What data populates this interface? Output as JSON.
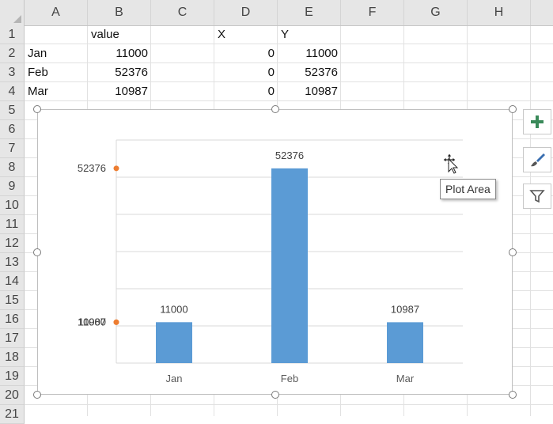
{
  "columns": [
    "A",
    "B",
    "C",
    "D",
    "E",
    "F",
    "G",
    "H"
  ],
  "rows": [
    "1",
    "2",
    "3",
    "4",
    "5",
    "6",
    "7",
    "8",
    "9",
    "10",
    "11",
    "12",
    "13",
    "14",
    "15",
    "16",
    "17",
    "18",
    "19",
    "20",
    "21"
  ],
  "cells": {
    "header": {
      "value": "value",
      "x": "X",
      "y": "Y"
    },
    "data": [
      {
        "label": "Jan",
        "value": "11000",
        "x": "0",
        "y": "11000"
      },
      {
        "label": "Feb",
        "value": "52376",
        "x": "0",
        "y": "52376"
      },
      {
        "label": "Mar",
        "value": "10987",
        "x": "0",
        "y": "10987"
      }
    ]
  },
  "chart_data": {
    "type": "bar",
    "categories": [
      "Jan",
      "Feb",
      "Mar"
    ],
    "values": [
      11000,
      52376,
      10987
    ],
    "data_labels": [
      "11000",
      "52376",
      "10987"
    ],
    "ylim": [
      0,
      60000
    ],
    "grid": true,
    "bar_color": "#5b9bd5",
    "overlay_scatter": {
      "color": "#ed7d31",
      "points": [
        {
          "x": 0,
          "y": 11000,
          "label": "11000"
        },
        {
          "x": 0,
          "y": 52376,
          "label": "52376"
        },
        {
          "x": 0,
          "y": 10987,
          "label": "10987"
        }
      ]
    }
  },
  "ui": {
    "tooltip": "Plot Area",
    "side_buttons": [
      "chart-elements-icon",
      "chart-styles-icon",
      "chart-filters-icon"
    ],
    "accent": "#217346"
  }
}
